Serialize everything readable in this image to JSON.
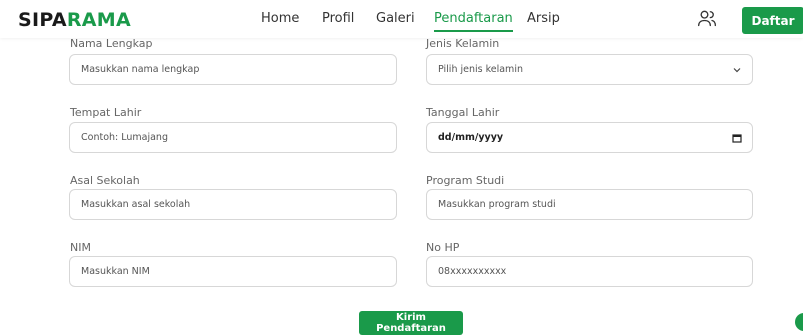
{
  "brand": {
    "part1": "SIPA",
    "part2": "RAMA",
    "accent_color": "#1a9a4a"
  },
  "nav": {
    "items": [
      {
        "label": "Home"
      },
      {
        "label": "Profil"
      },
      {
        "label": "Galeri"
      },
      {
        "label": "Pendaftaran",
        "active": true
      },
      {
        "label": "Arsip"
      }
    ],
    "user_icon": "users-icon",
    "daftar_label": "Daftar"
  },
  "form": {
    "nama": {
      "label": "Nama Lengkap",
      "placeholder": "Masukkan nama lengkap"
    },
    "jenis_kelamin": {
      "label": "Jenis Kelamin",
      "value": "Pilih jenis kelamin"
    },
    "tempat_lahir": {
      "label": "Tempat Lahir",
      "placeholder": "Contoh: Lumajang"
    },
    "tanggal_lahir": {
      "label": "Tanggal Lahir",
      "value": "dd/mm/yyyy"
    },
    "asal_sekolah": {
      "label": "Asal Sekolah",
      "placeholder": "Masukkan asal sekolah"
    },
    "program_studi": {
      "label": "Program Studi",
      "placeholder": "Masukkan program studi"
    },
    "nim": {
      "label": "NIM",
      "placeholder": "Masukkan NIM"
    },
    "no_hp": {
      "label": "No HP",
      "placeholder": "08xxxxxxxxxx"
    },
    "submit_label": "Kirim Pendaftaran"
  }
}
